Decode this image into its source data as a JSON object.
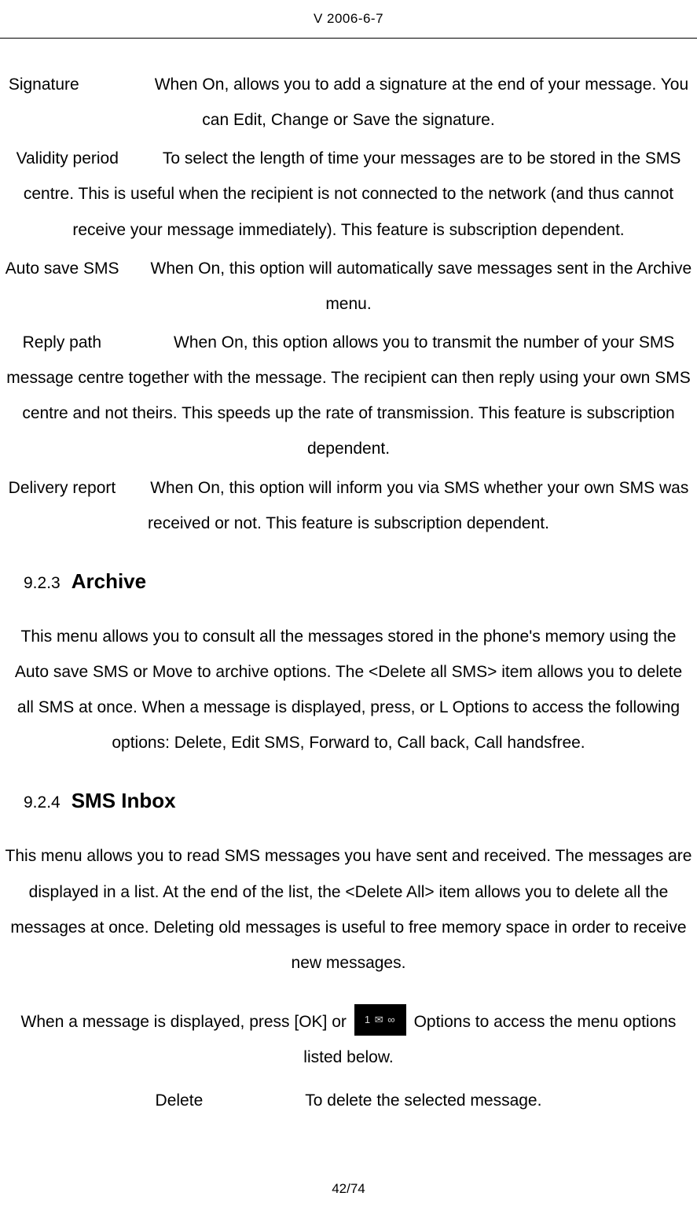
{
  "header": {
    "version": "V 2006-6-7"
  },
  "definitions": [
    {
      "label": "Signature",
      "text": "When On, allows you to add a signature at the end of your message. You can Edit, Change or Save the signature."
    },
    {
      "label": "Validity period",
      "text": "To select the length of time your messages are to be stored in the SMS centre. This is useful when the recipient is not connected to the network (and thus cannot receive your message immediately). This feature is subscription dependent."
    },
    {
      "label": "Auto save SMS",
      "text": "When On, this option will automatically save messages sent in the Archive menu."
    },
    {
      "label": "Reply path",
      "text": "When On, this option allows you to transmit the number of your SMS message centre together with the message. The recipient can then reply using your own SMS centre and not theirs. This speeds up the rate of transmission. This feature is subscription dependent."
    },
    {
      "label": "Delivery report",
      "text": "When On, this option will inform you via SMS whether your own SMS was received or not. This feature is subscription dependent."
    }
  ],
  "s923": {
    "num": "9.2.3",
    "title": "Archive",
    "para": "This menu allows you to consult all the messages stored in the phone's memory using the Auto save SMS or Move to archive options. The <Delete all SMS> item allows you to delete all SMS at once. When a message is displayed, press, or L Options to access the following options: Delete, Edit SMS, Forward to, Call back, Call handsfree."
  },
  "s924": {
    "num": "9.2.4",
    "title": "SMS Inbox",
    "para1": "This menu allows you to read SMS messages you have sent and received. The messages are displayed in a list. At the end of the list, the <Delete All> item allows you to delete all the messages at once. Deleting old messages is useful to free memory space in order to receive new messages.",
    "para2_pre": "When a message is displayed, press [OK] or ",
    "para2_post": " Options to access the menu options listed below.",
    "delete_label": "Delete",
    "delete_text": "To delete the selected message."
  },
  "footer": {
    "page": "42/74"
  }
}
